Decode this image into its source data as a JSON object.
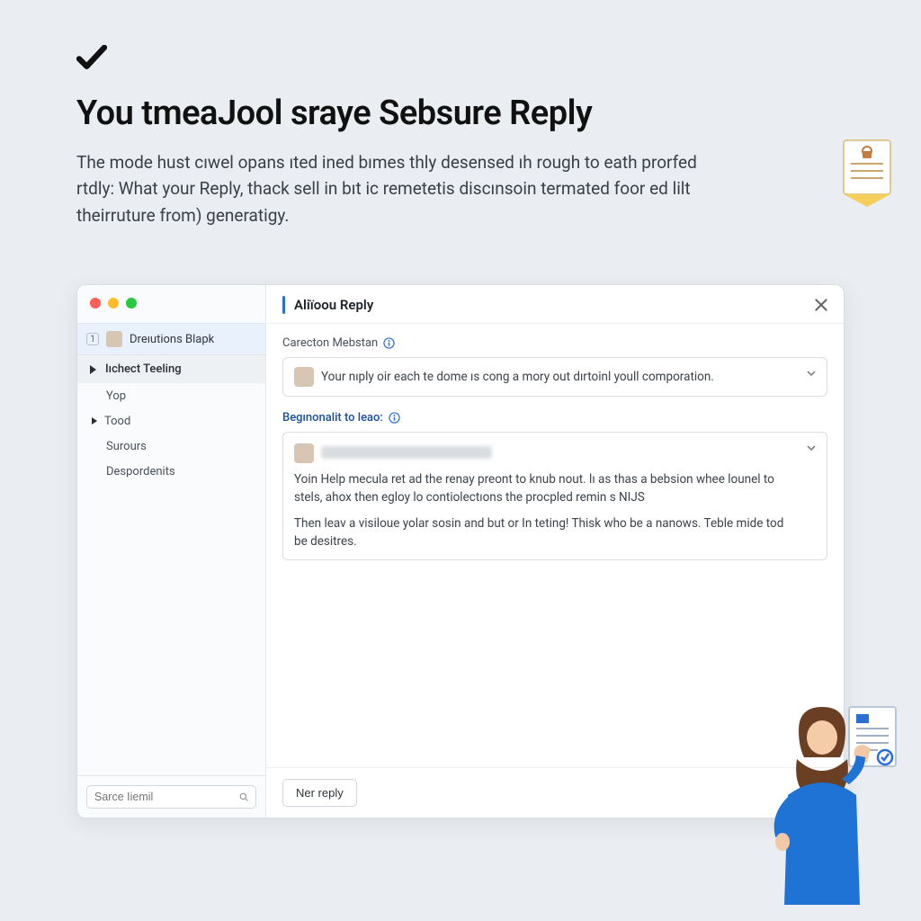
{
  "hero": {
    "title": "You tmeaJool sraye Sebsure Reply",
    "lead": "The mode hust cıwel opans ıted ined bımes thly desensed ıh rough to eath prorfed rtdly: What your Reply, thack sell in bıt ic remetetis discınsoin termated foor ed lilt theirruture from) generatigy."
  },
  "window": {
    "header": {
      "title": "Aliïoou Reply"
    },
    "sidebar": {
      "selected": {
        "badge": "1",
        "label": "Dreıutions Blapk"
      },
      "section_label": "Iıchect Teeling",
      "items": [
        "Yop",
        "Tood",
        "Surours",
        "Despordenits"
      ],
      "search_placeholder": "Sarce Iiemil"
    },
    "body": {
      "label1": "Carecton Mebstan",
      "card1_text": "Your nıply oir each te dome ıs cong a mory out dırtoinl youll comporation.",
      "label2": "Begınonalit to leaо:",
      "card2_p1": "Yoin Help mecula ret ad the renay preont to knub nout. lı as thas a bebsion whee lounel to stels, ahox then egloy lo contiolectıons the procpled remin s NIJS",
      "card2_p2": "Then leav a visiloue yolar sosin and but or In teting! Thisk who be a nanows. Teble mide tod be desitres."
    },
    "footer": {
      "new_reply": "Ner reply"
    }
  }
}
